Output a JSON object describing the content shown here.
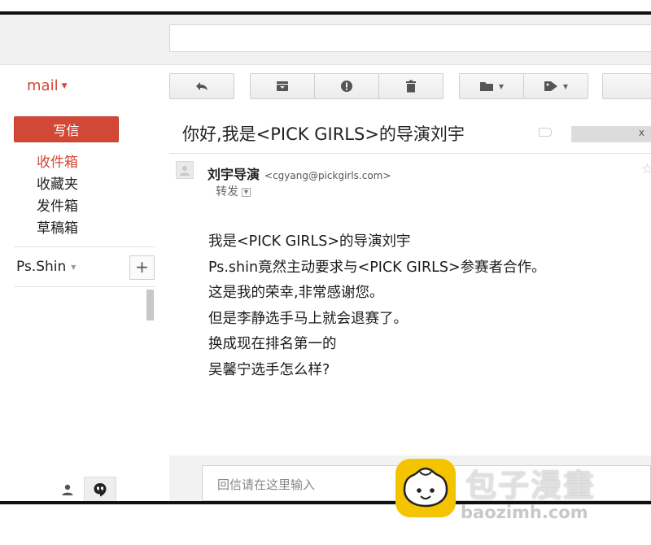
{
  "header": {
    "brand": "mail",
    "search": {
      "value": "",
      "placeholder": ""
    }
  },
  "sidebar": {
    "compose_label": "写信",
    "items": [
      {
        "label": "收件箱",
        "active": true
      },
      {
        "label": "收藏夹",
        "active": false
      },
      {
        "label": "发件箱",
        "active": false
      },
      {
        "label": "草稿箱",
        "active": false
      }
    ],
    "account_name": "Ps.Shin",
    "add_label": "+",
    "bottom_icons": [
      "person-icon",
      "hangouts-quote-icon"
    ]
  },
  "toolbar": {
    "buttons": [
      "reply-icon",
      "archive-icon",
      "report-spam-icon",
      "delete-icon",
      "folder-icon",
      "label-tag-icon"
    ]
  },
  "message": {
    "subject": "你好,我是<PICK GIRLS>的导演刘宇",
    "tag_close": "x",
    "sender_name": "刘宇导演",
    "sender_email": "<cgyang@pickgirls.com>",
    "forward_label": "转发",
    "body": [
      "我是<PICK GIRLS>的导演刘宇",
      "Ps.shin竟然主动要求与<PICK GIRLS>参赛者合作。",
      "这是我的荣幸,非常感谢您。",
      "但是李静选手马上就会退赛了。",
      "换成现在排名第一的",
      "吴馨宁选手怎么样?"
    ]
  },
  "reply": {
    "placeholder": "回信请在这里输入"
  },
  "watermark": {
    "text": "包子漫畫",
    "url": "baozimh.com"
  },
  "colors": {
    "accent": "#d14836",
    "watermark_logo": "#f5c400"
  }
}
